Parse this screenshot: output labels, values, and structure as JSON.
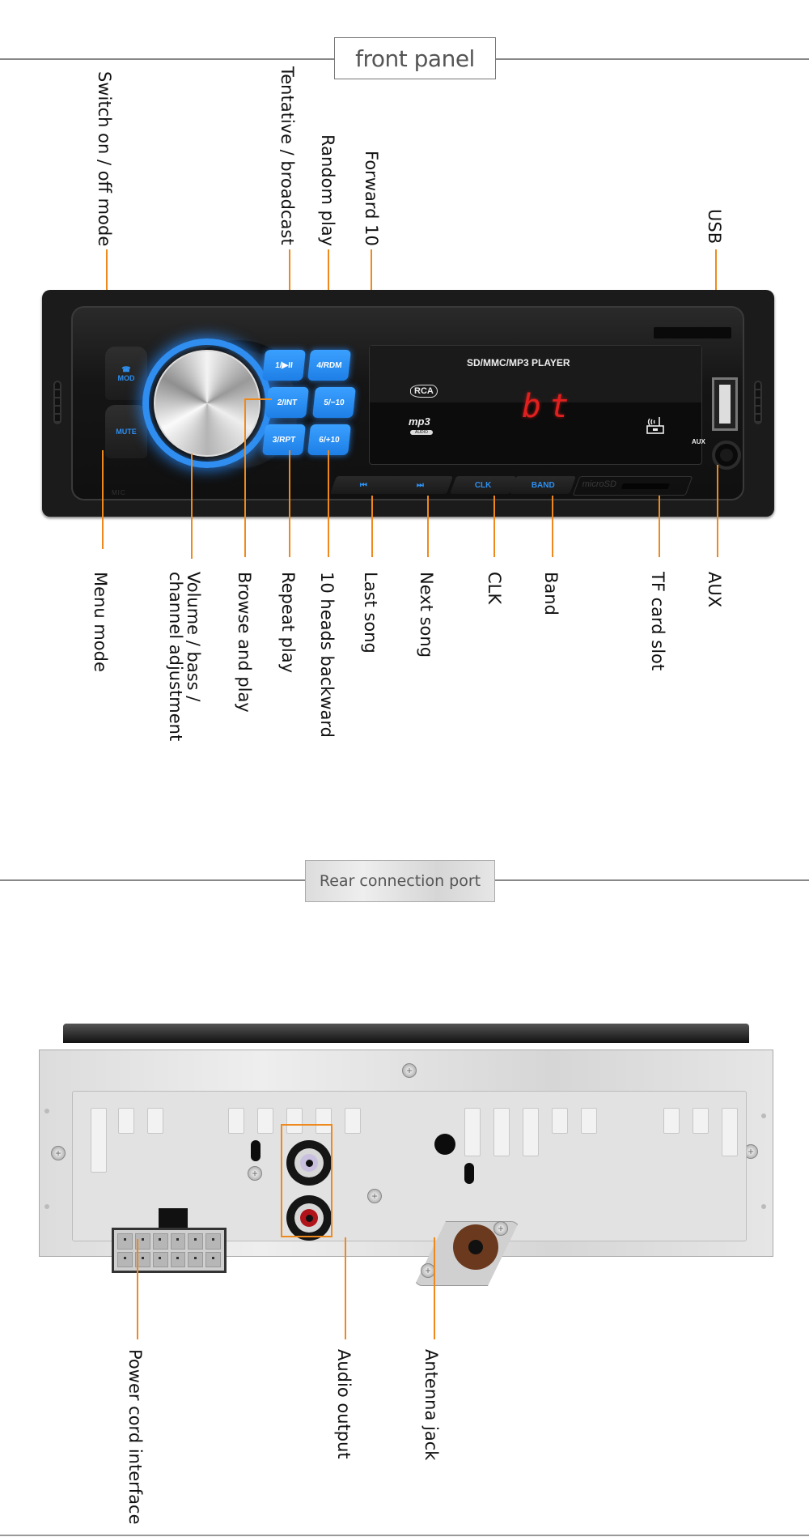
{
  "front_section": {
    "title": "front panel",
    "device": {
      "display_title": "SD/MMC/MP3 PLAYER",
      "display_readout": "bt",
      "rca_logo": "RCA",
      "mp3_logo": "mp3",
      "mp3_sub": "AUDIO",
      "aux_vertical": "AUX",
      "mic_label": "MIC",
      "microsd_label": "microSD",
      "buttons": {
        "mod": "MOD",
        "mute": "MUTE",
        "b1": "1/▶II",
        "b2": "2/INT",
        "b3": "3/RPT",
        "b4": "4/RDM",
        "b5": "5/−10",
        "b6": "6/+10",
        "prev": "⏮",
        "next": "⏭",
        "clk": "CLK",
        "band": "BAND"
      }
    },
    "top_labels": {
      "switch_mode": "Switch on / off mode",
      "tentative_broadcast": "Tentative / broadcast",
      "random_play": "Random play",
      "forward_10": "Forward 10",
      "usb": "USB"
    },
    "bottom_labels": {
      "menu_mode": "Menu mode",
      "volume": "Volume / bass /\nchannel adjustment",
      "browse_play": "Browse and play",
      "repeat_play": "Repeat play",
      "backward_10": "10 heads backward",
      "last_song": "Last song",
      "next_song": "Next song",
      "clk": "CLK",
      "band": "Band",
      "tf_slot": "TF card slot",
      "aux": "AUX"
    }
  },
  "rear_section": {
    "title": "Rear connection port",
    "labels": {
      "power": "Power cord interface",
      "audio": "Audio output",
      "antenna": "Antenna jack"
    }
  },
  "colors": {
    "leader": "#ee8a1d",
    "button_blue": "#2e8ff0",
    "segment_red": "#e0201e"
  }
}
